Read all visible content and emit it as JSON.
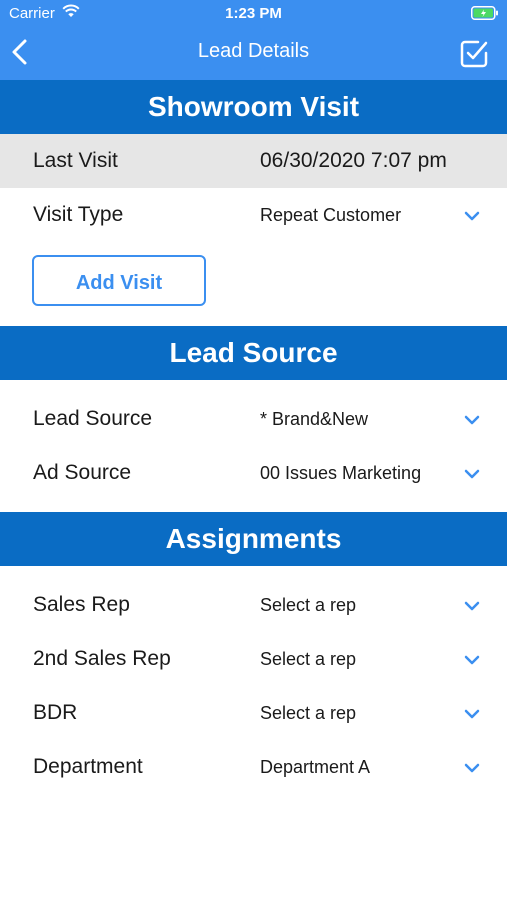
{
  "status_bar": {
    "carrier": "Carrier",
    "time": "1:23 PM"
  },
  "nav": {
    "title": "Lead Details"
  },
  "sections": {
    "showroom": {
      "title": "Showroom Visit",
      "last_visit": {
        "label": "Last Visit",
        "value": "06/30/2020 7:07 pm"
      },
      "visit_type": {
        "label": "Visit Type",
        "value": "Repeat Customer"
      },
      "add_visit_label": "Add Visit"
    },
    "lead_source": {
      "title": "Lead Source",
      "lead_source": {
        "label": "Lead Source",
        "value": "* Brand&New"
      },
      "ad_source": {
        "label": "Ad Source",
        "value": "00 Issues Marketing"
      }
    },
    "assignments": {
      "title": "Assignments",
      "sales_rep": {
        "label": "Sales Rep",
        "value": "Select a rep"
      },
      "second_sales_rep": {
        "label": "2nd Sales Rep",
        "value": "Select a rep"
      },
      "bdr": {
        "label": "BDR",
        "value": "Select a rep"
      },
      "department": {
        "label": "Department",
        "value": "Department A"
      }
    }
  },
  "colors": {
    "nav_blue": "#3b8ff0",
    "section_blue": "#0a6cc4",
    "row_shade": "#e6e6e6",
    "chevron": "#3b8ff0"
  },
  "icons": [
    "wifi-icon",
    "battery-icon",
    "back-chevron-icon",
    "checkbox-done-icon",
    "chevron-down-icon"
  ]
}
